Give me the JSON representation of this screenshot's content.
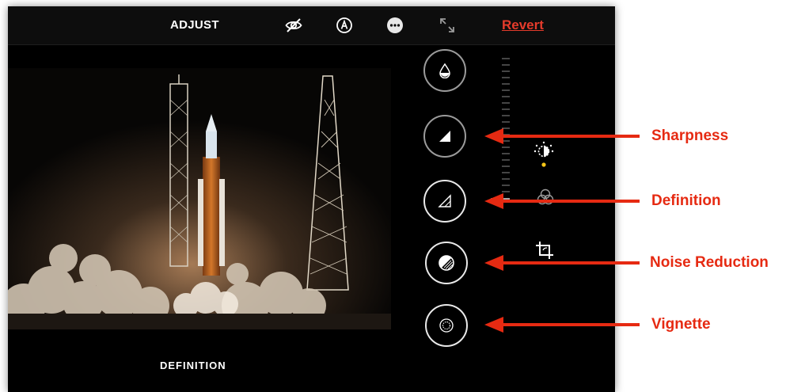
{
  "toolbar": {
    "title": "ADJUST",
    "revert_label": "Revert",
    "icons": [
      "eye-off-icon",
      "markup-icon",
      "more-icon",
      "expand-icon"
    ]
  },
  "editor": {
    "bottom_label": "DEFINITION",
    "tools": [
      "brilliance-tool",
      "sharpness-tool",
      "definition-tool",
      "noise-reduction-tool",
      "vignette-tool"
    ],
    "selected_tool": "definition-tool",
    "side_icons": [
      "adjust-icon",
      "filters-icon",
      "crop-icon"
    ]
  },
  "annotations": {
    "sharpness": "Sharpness",
    "definition": "Definition",
    "noise_reduction": "Noise Reduction",
    "vignette": "Vignette"
  },
  "colors": {
    "accent_red": "#e53b2b",
    "annotation_red": "#e62a12",
    "active_dot": "#f5c518",
    "panel_bg": "#000000"
  }
}
